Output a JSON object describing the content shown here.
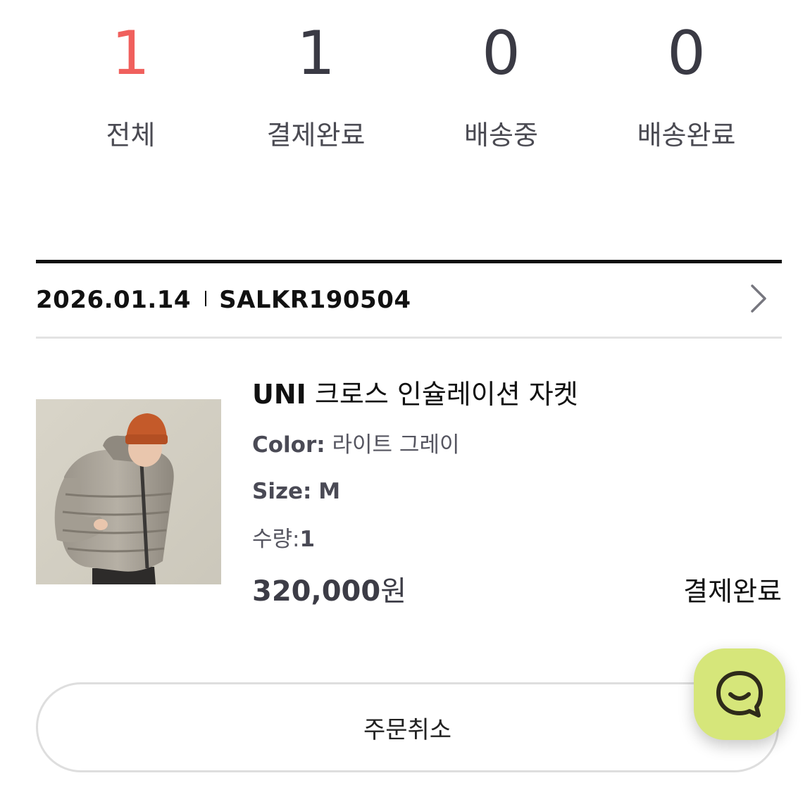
{
  "status_summary": {
    "items": [
      {
        "count": "1",
        "label": "전체"
      },
      {
        "count": "1",
        "label": "결제완료"
      },
      {
        "count": "0",
        "label": "배송중"
      },
      {
        "count": "0",
        "label": "배송완료"
      }
    ],
    "active_color": "#f0605d"
  },
  "order": {
    "date": "2026.01.14",
    "number": "SALKR190504",
    "detail_icon": "chevron-right-icon",
    "product": {
      "brand": "UNI",
      "name": "크로스 인슐레이션 자켓",
      "color_key": "Color:",
      "color_value": "라이트 그레이",
      "size_key": "Size:",
      "size_value": "M",
      "qty_key": "수량:",
      "qty_value": "1",
      "price_number": "320,000",
      "price_unit": "원",
      "status": "결제완료"
    },
    "cancel_label": "주문취소"
  },
  "chat_button": {
    "icon": "chat-smile-icon",
    "color": "#d6e67a"
  }
}
